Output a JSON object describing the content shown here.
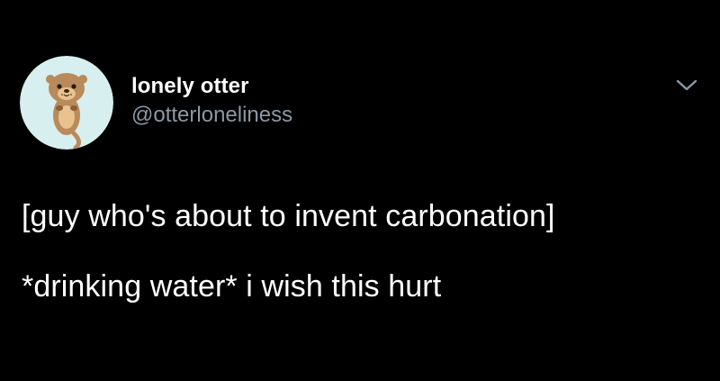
{
  "tweet": {
    "author": {
      "display_name": "lonely otter",
      "handle": "@otterloneliness",
      "avatar_icon": "otter-avatar-icon",
      "avatar_bg": "#d7efef"
    },
    "more_icon": "chevron-down-icon",
    "text_lines": [
      "[guy who's about to invent carbonation]",
      "*drinking water* i wish this hurt"
    ]
  },
  "colors": {
    "background": "#000000",
    "primary_text": "#ffffff",
    "secondary_text": "#8b98a5"
  }
}
